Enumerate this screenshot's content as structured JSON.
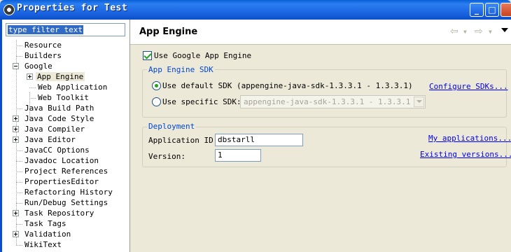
{
  "window": {
    "title": "Properties for Test"
  },
  "filter": {
    "text": "type filter text"
  },
  "tree": [
    "Resource",
    "Builders",
    "Google",
    "App Engine",
    "Web Application",
    "Web Toolkit",
    "Java Build Path",
    "Java Code Style",
    "Java Compiler",
    "Java Editor",
    "JavaCC Options",
    "Javadoc Location",
    "Project References",
    "PropertiesEditor",
    "Refactoring History",
    "Run/Debug Settings",
    "Task Repository",
    "Task Tags",
    "Validation",
    "WikiText"
  ],
  "page": {
    "title": "App Engine",
    "use_gae_label": "Use Google App Engine",
    "use_gae_checked": true,
    "sdk": {
      "legend": "App Engine SDK",
      "default_label": "Use default SDK (appengine-java-sdk-1.3.3.1 - 1.3.3.1)",
      "configure_link": "Configure SDKs...",
      "specific_label": "Use specific SDK:",
      "specific_value": "appengine-java-sdk-1.3.3.1 - 1.3.3.1",
      "selected": "default"
    },
    "deployment": {
      "legend": "Deployment",
      "app_id_label": "Application ID:",
      "app_id_value": "dbstarll",
      "version_label": "Version:",
      "version_value": "1",
      "my_apps_link": "My applications...",
      "existing_versions_link": "Existing versions..."
    }
  },
  "nav": {
    "back_icon": "back-arrow-icon",
    "forward_icon": "forward-arrow-icon",
    "menu_icon": "view-menu-icon"
  }
}
